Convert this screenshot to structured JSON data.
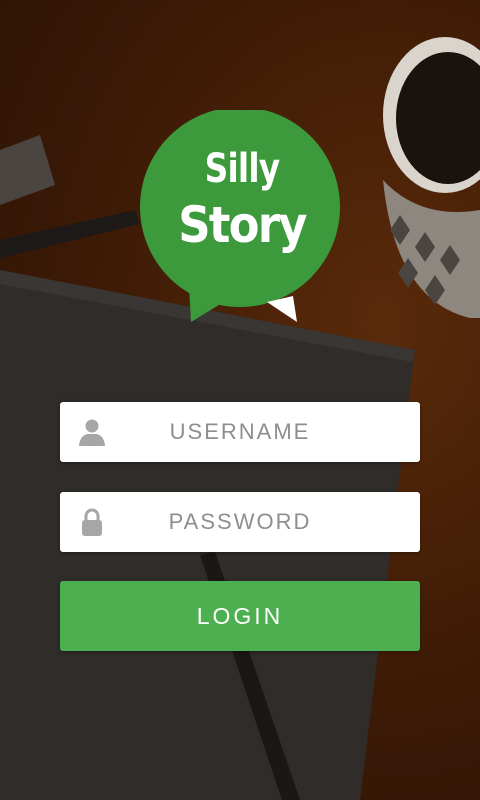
{
  "logo": {
    "line1": "Silly",
    "line2": "Story"
  },
  "username": {
    "placeholder": "USERNAME",
    "value": "",
    "icon": "user-icon"
  },
  "password": {
    "placeholder": "PASSWORD",
    "value": "",
    "icon": "lock-icon"
  },
  "login": {
    "label": "LOGIN"
  },
  "colors": {
    "accent": "#4caf50",
    "logo_green": "#3c9a3c",
    "background": "#3a1a06"
  }
}
